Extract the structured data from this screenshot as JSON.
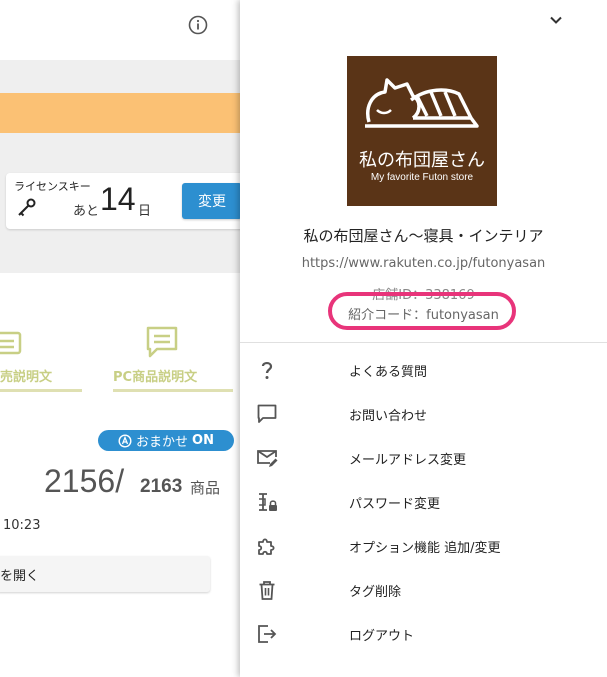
{
  "background": {
    "license": {
      "label": "ライセンスキー",
      "ato": "あと",
      "days": "14",
      "nichi": "日",
      "change_button": "変更"
    },
    "desc_tabs": [
      "売説明文",
      "PC商品説明文"
    ],
    "omakase": {
      "label": "おまかせ",
      "state": "ON"
    },
    "counts": {
      "done": "2156",
      "separator": "/",
      "total": "2163",
      "unit": "商品"
    },
    "time": "10:23",
    "open_button": "を開く"
  },
  "panel": {
    "logo": {
      "title": "私の布団屋さん",
      "subtitle": "My favorite Futon store"
    },
    "shop_name": "私の布団屋さん〜寝具・インテリア",
    "shop_url": "https://www.rakuten.co.jp/futonyasan",
    "shop_id": "店舗ID：338169",
    "referral_code": "紹介コード：futonyasan",
    "menu": [
      {
        "icon": "help-icon",
        "label": "よくある質問"
      },
      {
        "icon": "chat-icon",
        "label": "お問い合わせ"
      },
      {
        "icon": "mail-edit-icon",
        "label": "メールアドレス変更"
      },
      {
        "icon": "password-icon",
        "label": "パスワード変更"
      },
      {
        "icon": "puzzle-icon",
        "label": "オプション機能 追加/変更"
      },
      {
        "icon": "trash-icon",
        "label": "タグ削除"
      },
      {
        "icon": "logout-icon",
        "label": "ログアウト"
      }
    ]
  },
  "colors": {
    "accent_blue": "#2d8fd0",
    "orange_band": "#fbc174",
    "highlight_oval": "#e8347a",
    "logo_brown": "#5a3417"
  }
}
